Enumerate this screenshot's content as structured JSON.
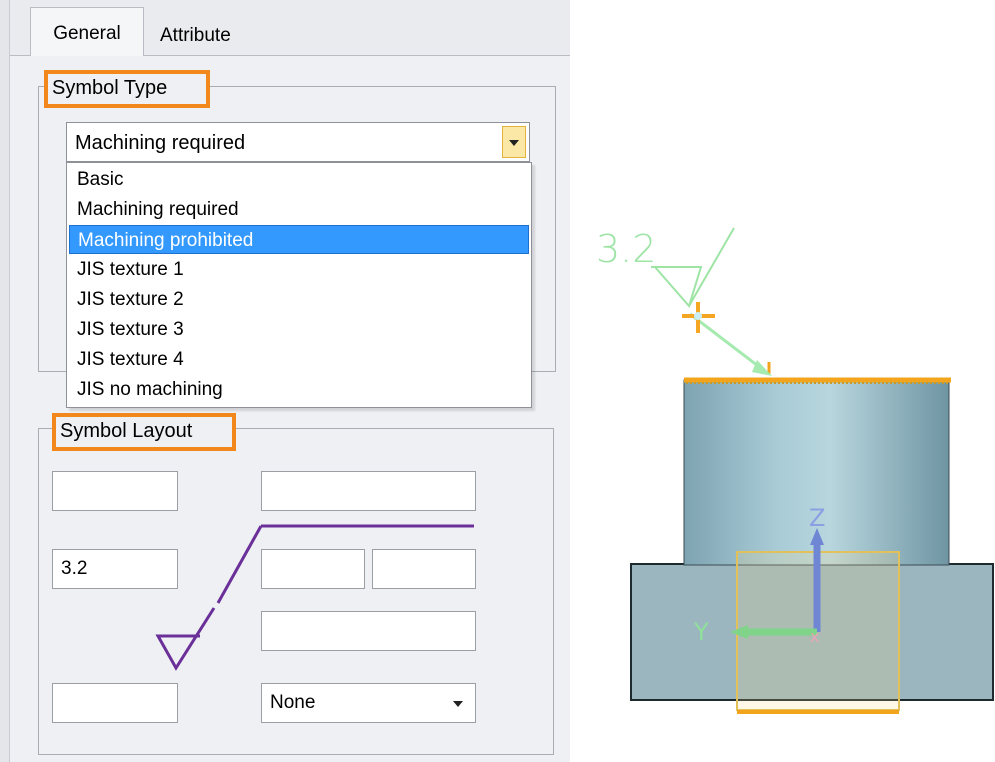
{
  "tabs": {
    "general": "General",
    "attribute": "Attribute"
  },
  "symbol_type": {
    "legend": "Symbol Type",
    "selected_value": "Machining required",
    "options": [
      "Basic",
      "Machining required",
      "Machining prohibited",
      "JIS texture 1",
      "JIS texture 2",
      "JIS texture 3",
      "JIS texture 4",
      "JIS no machining"
    ],
    "highlighted_option": "Machining prohibited"
  },
  "symbol_layout": {
    "legend": "Symbol Layout",
    "field_top_left": "",
    "field_top_right": "",
    "field_left_value": "3.2",
    "field_mid_a": "",
    "field_mid_b": "",
    "field_lower_right": "",
    "field_bottom_left": "",
    "direction_value": "None"
  },
  "viewport": {
    "roughness_label": "3.2",
    "axis_z": "Z",
    "axis_y": "Y"
  },
  "colors": {
    "highlight": "#3399ff",
    "accent_orange": "#f2871c",
    "symbol_line": "#6a2f99",
    "annotation_green": "#7ddc8a"
  }
}
